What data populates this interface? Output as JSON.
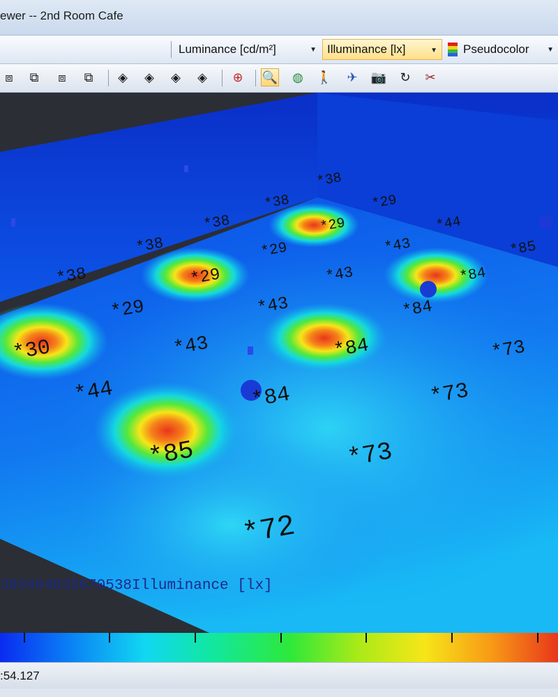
{
  "window": {
    "title": "ewer -- 2nd Room Cafe"
  },
  "toolbar": {
    "combo_luminance": "Luminance [cd/m²]",
    "combo_illuminance": "Illuminance [lx]",
    "combo_pseudocolor": "Pseudocolor"
  },
  "tools": {
    "view_tools": [
      "cube-front-icon",
      "cube-side-icon",
      "cube-top-icon",
      "cube-iso-icon"
    ],
    "nav_tools": [
      "rotate-view-1-icon",
      "rotate-view-2-icon",
      "rotate-view-3-icon",
      "rotate-view-4-icon"
    ],
    "action_tools": [
      "crosshair-icon",
      "zoom-icon",
      "globe-icon",
      "walk-icon",
      "fly-icon",
      "camera-icon",
      "refresh-icon",
      "scissors-icon"
    ]
  },
  "viewport": {
    "overlay_text": "383494035670538Illuminance [lx]",
    "labels": [
      "*38",
      "*38",
      "*38",
      "*38",
      "*38",
      "*30",
      "*29",
      "*29",
      "*29",
      "*29",
      "*29",
      "*44",
      "*43",
      "*43",
      "*43",
      "*43",
      "*84",
      "*84",
      "*84",
      "*84",
      "*85",
      "*85",
      "*73",
      "*73",
      "*73",
      "*72",
      "*30",
      "*44",
      "*84",
      "*73"
    ]
  },
  "colors": {
    "floor_low": "#0a3bf0",
    "floor_mid": "#19d7f2",
    "hotspot_center": "#e8361b",
    "hotspot_ring": "#f6e618"
  },
  "status": {
    "text": ":54.127"
  }
}
